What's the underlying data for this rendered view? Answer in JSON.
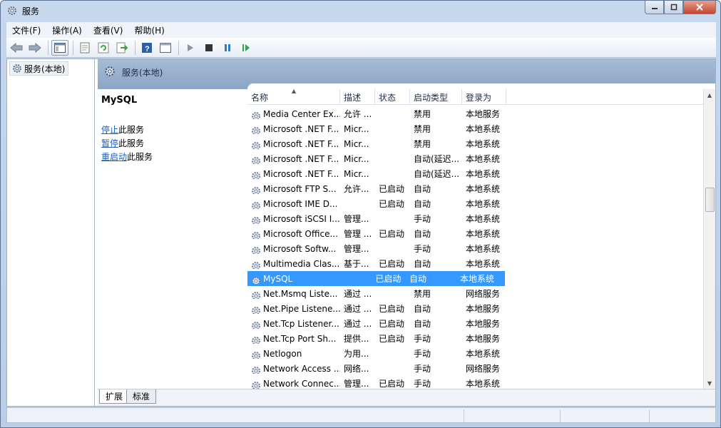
{
  "window": {
    "title": "服务"
  },
  "menu": [
    "文件(F)",
    "操作(A)",
    "查看(V)",
    "帮助(H)"
  ],
  "toolbar": {
    "buttons": [
      "back-icon",
      "forward-icon",
      "console-tree-icon",
      "properties-icon",
      "refresh-icon",
      "export-icon",
      "help-icon",
      "view-icon",
      "start-icon",
      "stop-icon",
      "pause-icon",
      "resume-icon"
    ]
  },
  "tree": {
    "root": "服务(本地)"
  },
  "pane": {
    "header": "服务(本地)"
  },
  "description": {
    "service_name": "MySQL",
    "actions": [
      {
        "link": "停止",
        "suffix": "此服务"
      },
      {
        "link": "暂停",
        "suffix": "此服务"
      },
      {
        "link": "重启动",
        "suffix": "此服务"
      }
    ]
  },
  "columns": [
    "名称",
    "描述",
    "状态",
    "启动类型",
    "登录为"
  ],
  "services": [
    {
      "name": "Media Center Ex...",
      "desc": "允许 ...",
      "status": "",
      "start": "禁用",
      "logon": "本地服务"
    },
    {
      "name": "Microsoft .NET F...",
      "desc": "Micr...",
      "status": "",
      "start": "禁用",
      "logon": "本地系统"
    },
    {
      "name": "Microsoft .NET F...",
      "desc": "Micr...",
      "status": "",
      "start": "禁用",
      "logon": "本地系统"
    },
    {
      "name": "Microsoft .NET F...",
      "desc": "Micr...",
      "status": "",
      "start": "自动(延迟...",
      "logon": "本地系统"
    },
    {
      "name": "Microsoft .NET F...",
      "desc": "Micr...",
      "status": "",
      "start": "自动(延迟...",
      "logon": "本地系统"
    },
    {
      "name": "Microsoft FTP S...",
      "desc": "允许...",
      "status": "已启动",
      "start": "自动",
      "logon": "本地系统"
    },
    {
      "name": "Microsoft IME D...",
      "desc": "",
      "status": "已启动",
      "start": "自动",
      "logon": "本地系统"
    },
    {
      "name": "Microsoft iSCSI I...",
      "desc": "管理...",
      "status": "",
      "start": "手动",
      "logon": "本地系统"
    },
    {
      "name": "Microsoft Office...",
      "desc": "管理 ...",
      "status": "已启动",
      "start": "自动",
      "logon": "本地系统"
    },
    {
      "name": "Microsoft Softw...",
      "desc": "管理...",
      "status": "",
      "start": "手动",
      "logon": "本地系统"
    },
    {
      "name": "Multimedia Clas...",
      "desc": "基于...",
      "status": "已启动",
      "start": "自动",
      "logon": "本地系统"
    },
    {
      "name": "MySQL",
      "desc": "",
      "status": "已启动",
      "start": "自动",
      "logon": "本地系统",
      "selected": true
    },
    {
      "name": "Net.Msmq Liste...",
      "desc": "通过 ...",
      "status": "",
      "start": "禁用",
      "logon": "网络服务"
    },
    {
      "name": "Net.Pipe Listene...",
      "desc": "通过 ...",
      "status": "已启动",
      "start": "自动",
      "logon": "本地服务"
    },
    {
      "name": "Net.Tcp Listener...",
      "desc": "通过 ...",
      "status": "已启动",
      "start": "自动",
      "logon": "本地服务"
    },
    {
      "name": "Net.Tcp Port Sh...",
      "desc": "提供...",
      "status": "已启动",
      "start": "手动",
      "logon": "本地服务"
    },
    {
      "name": "Netlogon",
      "desc": "为用...",
      "status": "",
      "start": "手动",
      "logon": "本地系统"
    },
    {
      "name": "Network Access ...",
      "desc": "网络...",
      "status": "",
      "start": "手动",
      "logon": "网络服务"
    },
    {
      "name": "Network Connec...",
      "desc": "管理...",
      "status": "已启动",
      "start": "手动",
      "logon": "本地系统"
    }
  ],
  "tabs": [
    "扩展",
    "标准"
  ]
}
